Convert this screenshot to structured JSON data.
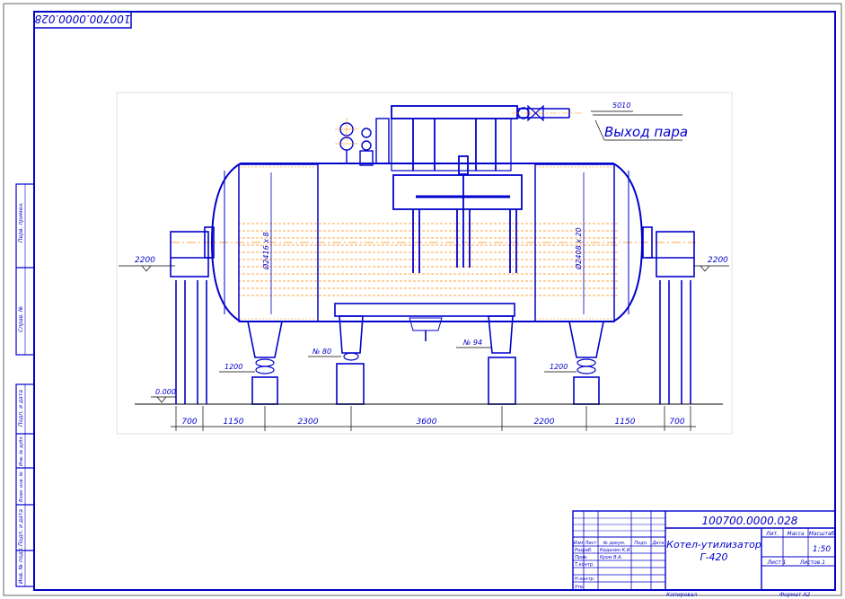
{
  "drawing": {
    "number": "100700.0000.028",
    "number_mirrored": "100700.0000.028",
    "title_line1": "Котел-утилизатор",
    "title_line2": "Г-420",
    "scale": "1:50",
    "sheet": "Лист 1",
    "sheets": "Листов 1",
    "copied": "Копировал",
    "format": "Формат  А2"
  },
  "title_block": {
    "head_cols": [
      "Лит.",
      "Масса",
      "Масштаб"
    ],
    "left_cols": [
      "Изм",
      "Лист",
      "№ докум.",
      "Подп.",
      "Дата"
    ],
    "rows": [
      "Разраб.",
      "Пров.",
      "Т.контр.",
      "",
      "Н.контр.",
      "Утв."
    ],
    "names": [
      "Кидалин К.И.",
      "Кром В.А."
    ]
  },
  "side_stamp": [
    "Перв. примен.",
    "Справ. №",
    "Подп. и дата",
    "Инв. № дубл.",
    "Взам. инв. №",
    "Подп. и дата",
    "Инв. № подл."
  ],
  "labels": {
    "steam_outlet": "Выход пара",
    "steam_pipe": "5010",
    "elev_left": "2200",
    "elev_right": "2200",
    "elev_zero": "0.000",
    "support_left": "1200",
    "support_right": "1200",
    "leg_mid_left": "№ 80",
    "leg_mid_right": "№ 94",
    "diam_left": "Ø2416 х 8",
    "diam_right": "Ø2408 х 20"
  },
  "dimensions": [
    "700",
    "1150",
    "2300",
    "3600",
    "2200",
    "1150",
    "700"
  ]
}
